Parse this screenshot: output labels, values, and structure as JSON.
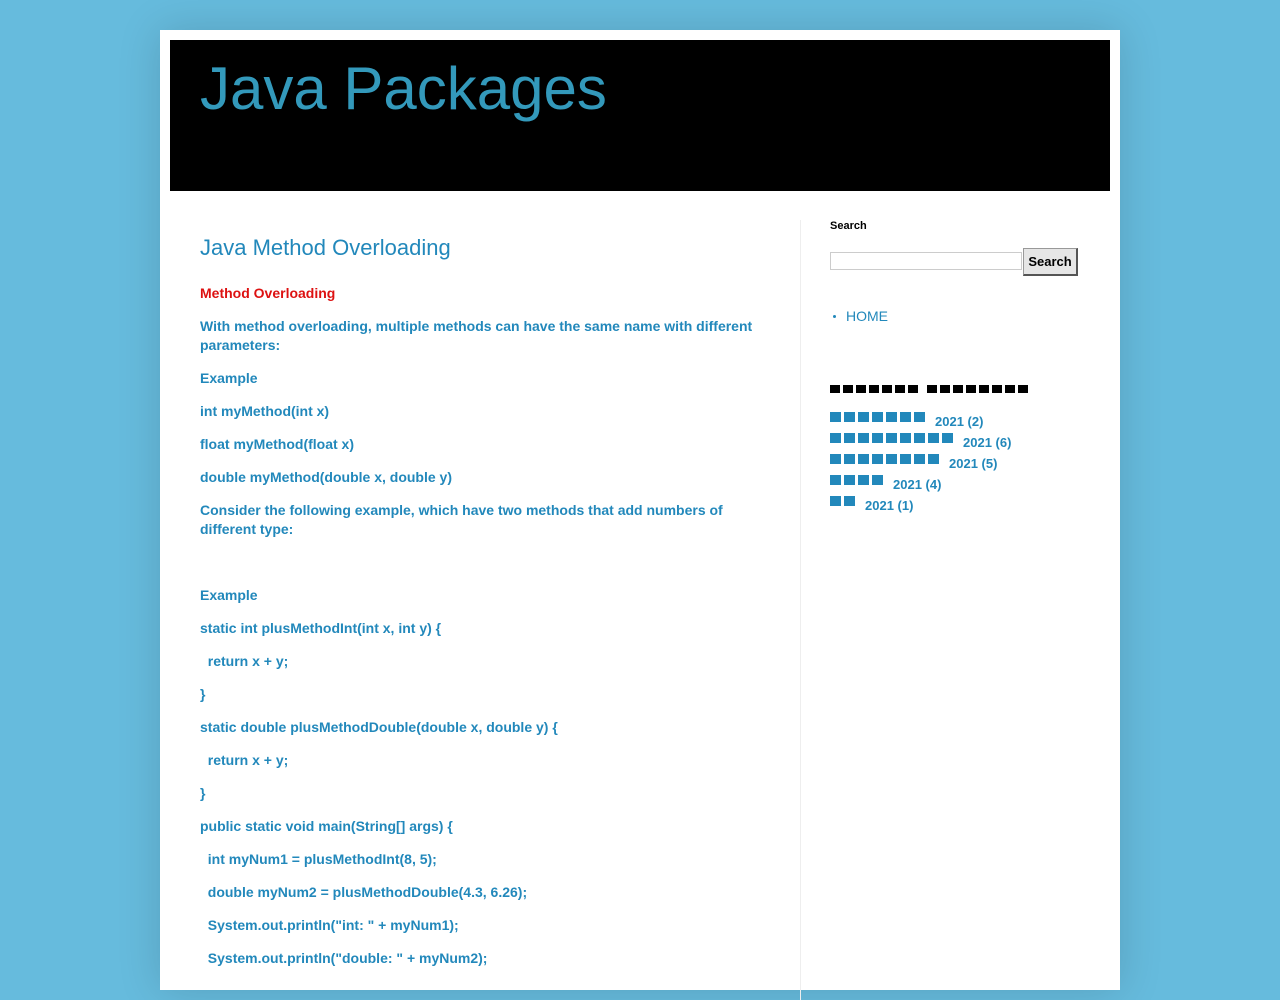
{
  "blog": {
    "title": "Java Packages"
  },
  "post": {
    "title": "Java Method Overloading",
    "paragraphs": [
      {
        "text": "Method Overloading",
        "style": "red"
      },
      {
        "text": "With method overloading, multiple methods can have the same name with different parameters:",
        "style": ""
      },
      {
        "text": "Example",
        "style": ""
      },
      {
        "text": "int myMethod(int x)",
        "style": ""
      },
      {
        "text": "float myMethod(float x)",
        "style": ""
      },
      {
        "text": "double myMethod(double x, double y)",
        "style": ""
      },
      {
        "text": "Consider the following example, which have two methods that add numbers of different type:",
        "style": ""
      },
      {
        "text": "",
        "style": "spacer"
      },
      {
        "text": "Example",
        "style": ""
      },
      {
        "text": "static int plusMethodInt(int x, int y) {",
        "style": ""
      },
      {
        "text": "  return x + y;",
        "style": ""
      },
      {
        "text": "}",
        "style": ""
      },
      {
        "text": "static double plusMethodDouble(double x, double y) {",
        "style": ""
      },
      {
        "text": "  return x + y;",
        "style": ""
      },
      {
        "text": "}",
        "style": ""
      },
      {
        "text": "public static void main(String[] args) {",
        "style": ""
      },
      {
        "text": "  int myNum1 = plusMethodInt(8, 5);",
        "style": ""
      },
      {
        "text": "  double myNum2 = plusMethodDouble(4.3, 6.26);",
        "style": ""
      },
      {
        "text": "  System.out.println(\"int: \" + myNum1);",
        "style": ""
      },
      {
        "text": "  System.out.println(\"double: \" + myNum2);",
        "style": ""
      }
    ]
  },
  "sidebar": {
    "search": {
      "title": "Search",
      "placeholder": "",
      "button_label": "Search"
    },
    "pages": [
      {
        "label": "HOME"
      }
    ],
    "archive": {
      "title_box_groups": [
        7,
        8
      ],
      "items": [
        {
          "boxes": 7,
          "label": "2021 (2)"
        },
        {
          "boxes": 9,
          "label": "2021 (6)"
        },
        {
          "boxes": 8,
          "label": "2021 (5)"
        },
        {
          "boxes": 4,
          "label": "2021 (4)"
        },
        {
          "boxes": 2,
          "label": "2021 (1)"
        }
      ]
    }
  },
  "colors": {
    "page_bg": "#66bbdd",
    "header_bg": "#000000",
    "title": "#3399bb",
    "link": "#2288bb",
    "emphasis": "#dd1111"
  }
}
